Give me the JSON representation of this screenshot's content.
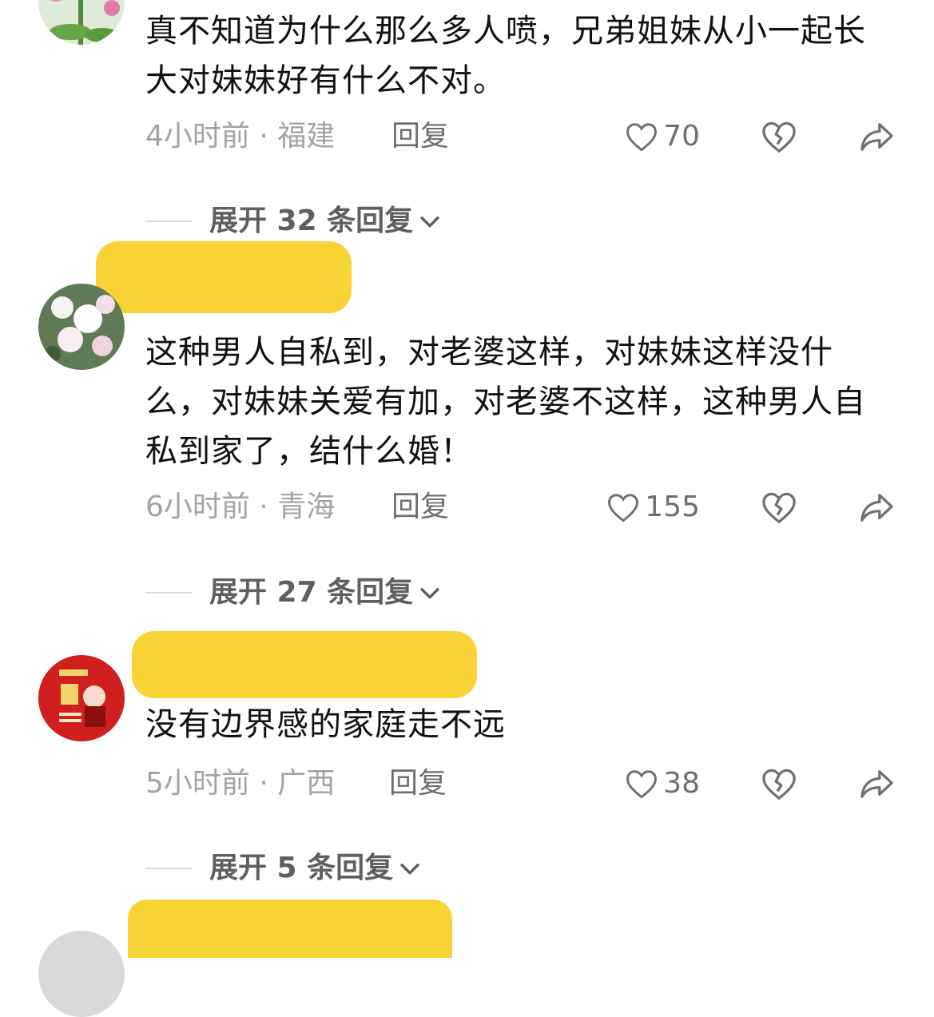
{
  "colors": {
    "text": "#111111",
    "meta": "#a3a3a3",
    "action": "#6f6f6f",
    "mask": "#f8d22f"
  },
  "comments": [
    {
      "text": "真不知道为什么那么多人喷，兄弟姐妹从小一起长大对妹妹好有什么不对。",
      "time_location": "4小时前 · 福建",
      "reply_label": "回复",
      "likes": "70",
      "expand_label": "展开 32 条回复"
    },
    {
      "text": "这种男人自私到，对老婆这样，对妹妹这样没什么，对妹妹关爱有加，对老婆不这样，这种男人自私到家了，结什么婚！",
      "time_location": "6小时前 · 青海",
      "reply_label": "回复",
      "likes": "155",
      "expand_label": "展开 27 条回复"
    },
    {
      "text": "没有边界感的家庭走不远",
      "time_location": "5小时前 · 广西",
      "reply_label": "回复",
      "likes": "38",
      "expand_label": "展开 5 条回复"
    }
  ]
}
